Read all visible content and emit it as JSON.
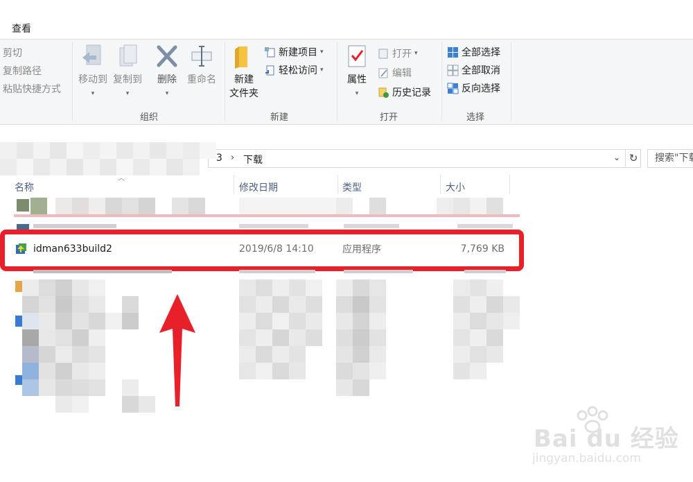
{
  "ribbon": {
    "tab_view": "查看",
    "clipboard": {
      "cut": "剪切",
      "copy_path": "复制路径",
      "paste_shortcut": "粘贴快捷方式"
    },
    "organize": {
      "move_to": "移动到",
      "copy_to": "复制到",
      "delete": "删除",
      "rename": "重命名",
      "group_label": "组织"
    },
    "new": {
      "new_folder_line1": "新建",
      "new_folder_line2": "文件夹",
      "new_item": "新建项目",
      "easy_access": "轻松访问",
      "group_label": "新建"
    },
    "open": {
      "properties": "属性",
      "open": "打开",
      "edit": "编辑",
      "history": "历史记录",
      "group_label": "打开"
    },
    "select": {
      "select_all": "全部选择",
      "select_none": "全部取消",
      "invert_selection": "反向选择",
      "group_label": "选择"
    }
  },
  "address": {
    "path_partial": "3",
    "current_folder": "下载",
    "search_placeholder": "搜索\"下载\""
  },
  "columns": {
    "name": "名称",
    "date": "修改日期",
    "type": "类型",
    "size": "大小"
  },
  "files": [
    {
      "name": "idman633build2",
      "date": "2019/6/8 14:10",
      "type": "应用程序",
      "size": "7,769 KB"
    }
  ],
  "colors": {
    "highlight": "#e8202a",
    "arrow": "#e8202a",
    "header_text": "#4d6082"
  },
  "watermark": {
    "brand": "Bai du 经验",
    "url": "jingyan.baidu.com"
  }
}
